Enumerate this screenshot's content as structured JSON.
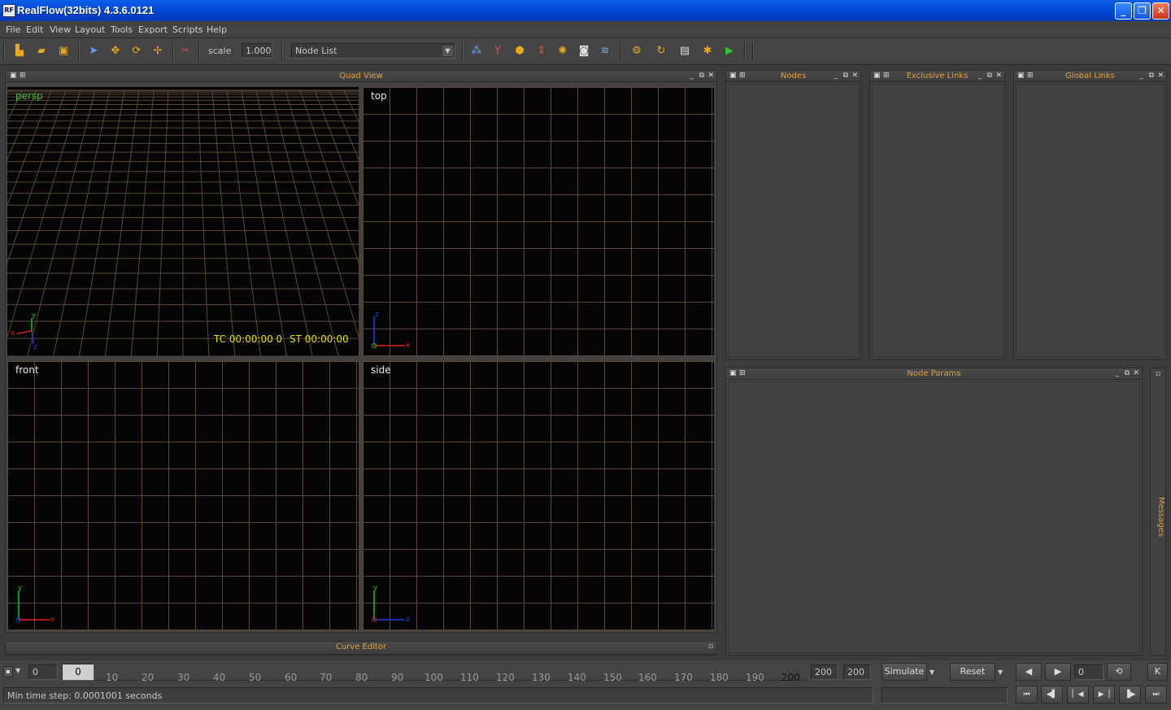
{
  "window": {
    "title": "RealFlow(32bits) 4.3.6.0121",
    "icon": "RF"
  },
  "window_controls": {
    "minimize": "_",
    "maximize": "❐",
    "close": "✕"
  },
  "menu": [
    "File",
    "Edit",
    "View",
    "Layout",
    "Tools",
    "Export",
    "Scripts",
    "Help"
  ],
  "toolbar": {
    "scale_label": "scale",
    "scale_value": "1.000",
    "node_list": "Node List"
  },
  "quad_view": {
    "title": "Quad View",
    "persp_label": "persp",
    "top_label": "top",
    "front_label": "front",
    "side_label": "side",
    "tc": "TC 00:00:00 0",
    "st": "ST 00:00:00",
    "axis_labels": {
      "x": "x",
      "y": "y",
      "z": "z"
    }
  },
  "panels": {
    "nodes": "Nodes",
    "exclusive_links": "Exclusive Links",
    "global_links": "Global Links",
    "node_params": "Node Params",
    "messages": "Messages",
    "curve_editor": "Curve Editor"
  },
  "timeline": {
    "start_field": "0",
    "current_frame": "0",
    "ticks": [
      "10",
      "20",
      "30",
      "40",
      "50",
      "60",
      "70",
      "80",
      "90",
      "100",
      "110",
      "120",
      "130",
      "140",
      "150",
      "160",
      "170",
      "180",
      "190",
      "200"
    ],
    "end_field_1": "200",
    "end_field_2": "200",
    "simulate_label": "Simulate",
    "reset_label": "Reset",
    "frame_field": "0",
    "k_label": "K",
    "status": "Min time step: 0.0001001 seconds"
  },
  "colors": {
    "accent_orange": "#e0a040",
    "grid_brown": "#5a4a32",
    "axis_red": "#e02020",
    "axis_green": "#20c020",
    "axis_blue": "#2040e0",
    "overlay_yellow": "#e8e000",
    "persp_green": "#40c040"
  }
}
